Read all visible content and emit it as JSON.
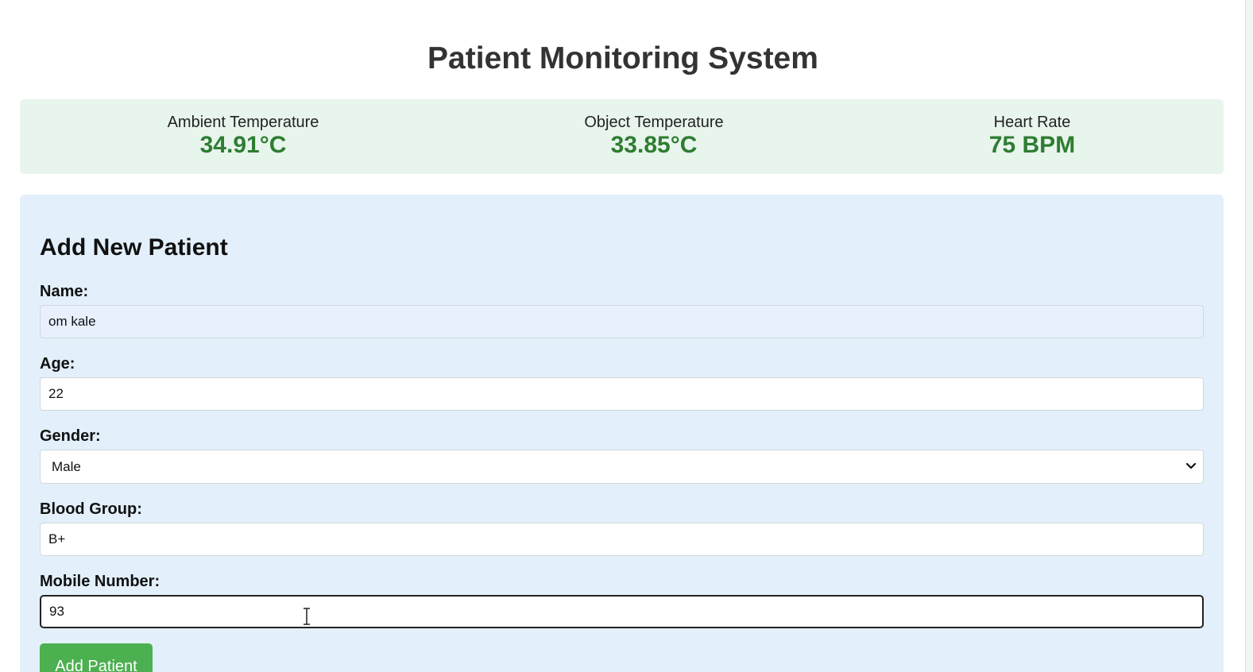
{
  "header": {
    "title": "Patient Monitoring System"
  },
  "stats": {
    "ambient": {
      "label": "Ambient Temperature",
      "value": "34.91°C"
    },
    "object": {
      "label": "Object Temperature",
      "value": "33.85°C"
    },
    "heart_rate": {
      "label": "Heart Rate",
      "value": "75 BPM"
    }
  },
  "form": {
    "title": "Add New Patient",
    "name": {
      "label": "Name:",
      "value": "om kale"
    },
    "age": {
      "label": "Age:",
      "value": "22"
    },
    "gender": {
      "label": "Gender:",
      "selected": "Male"
    },
    "blood_group": {
      "label": "Blood Group:",
      "value": "B+"
    },
    "mobile": {
      "label": "Mobile Number:",
      "value": "93"
    },
    "submit_label": "Add Patient"
  },
  "colors": {
    "stats_background": "#e8f5ec",
    "stat_value": "#2e7d32",
    "form_background": "#e3f0fb",
    "button": "#4caf50",
    "autofill_background": "#e8f0fe"
  }
}
